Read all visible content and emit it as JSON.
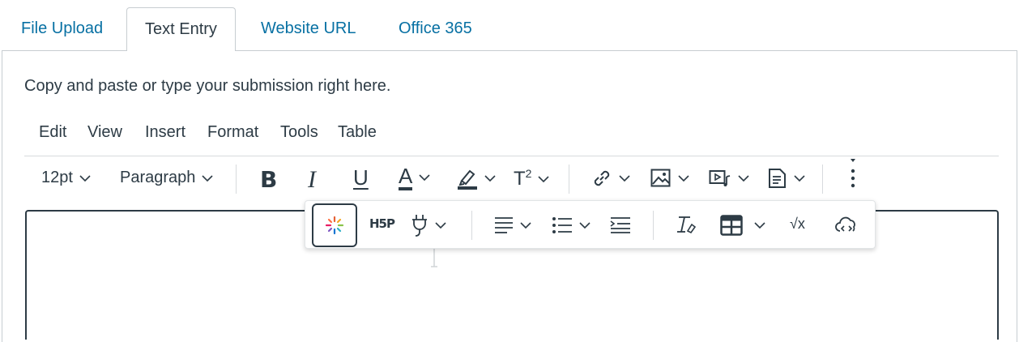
{
  "tabs": [
    {
      "label": "File Upload",
      "active": false
    },
    {
      "label": "Text Entry",
      "active": true
    },
    {
      "label": "Website URL",
      "active": false
    },
    {
      "label": "Office 365",
      "active": false
    }
  ],
  "instruction": "Copy and paste or type your submission right here.",
  "menubar": [
    "Edit",
    "View",
    "Insert",
    "Format",
    "Tools",
    "Table"
  ],
  "toolbar": {
    "font_size": "12pt",
    "block_format": "Paragraph",
    "bold": "B",
    "italic": "I",
    "underline": "U",
    "text_color": "A",
    "superscript": "T",
    "superscript_mark": "2"
  },
  "overflow_toolbar": {
    "h5p": "H5P",
    "sqrt": "√x"
  },
  "colors": {
    "link": "#0770a3",
    "text": "#2d3b45",
    "border": "#c7cdd1"
  }
}
